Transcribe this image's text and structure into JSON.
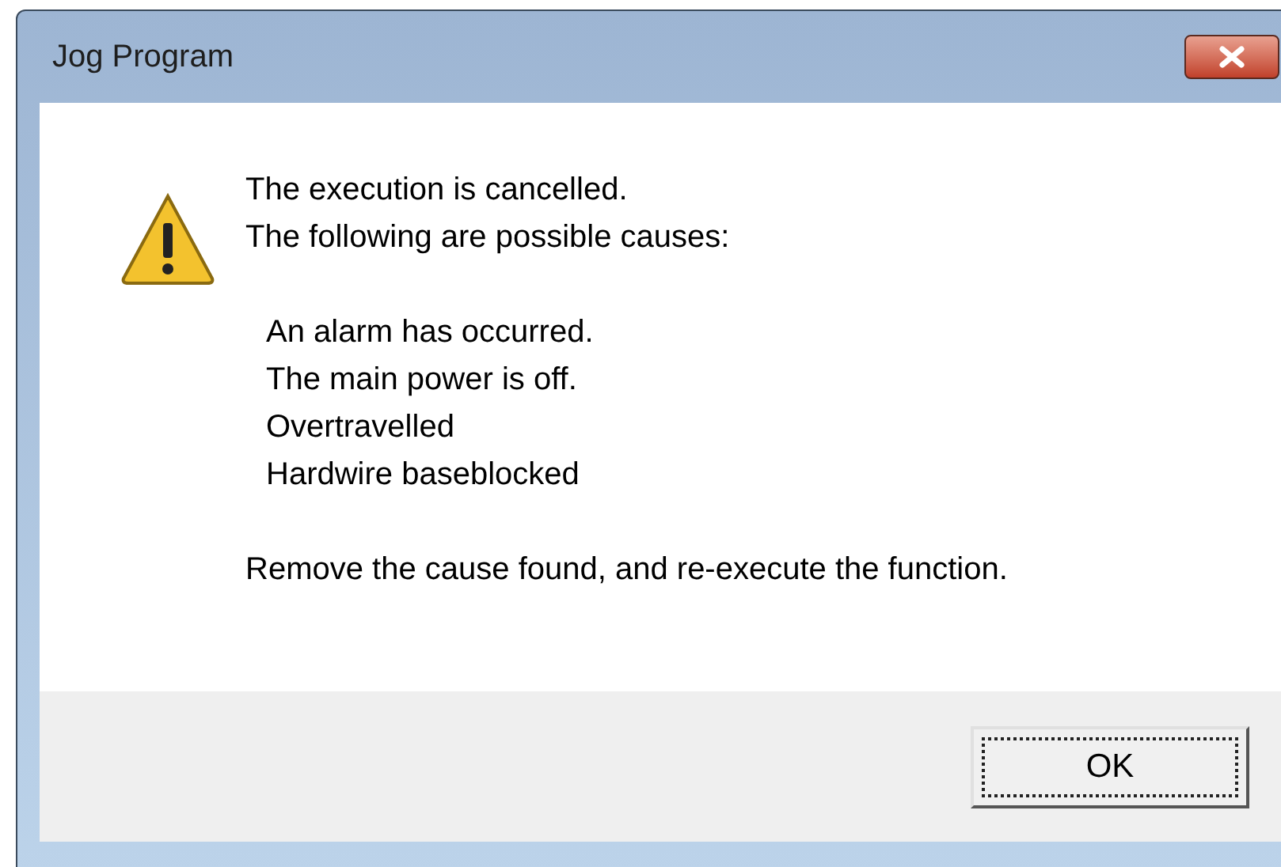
{
  "window": {
    "title": "Jog Program"
  },
  "message": {
    "lines": [
      "The execution is cancelled.",
      "The following are possible causes:"
    ],
    "causes": [
      "An alarm has occurred.",
      "The main power is off.",
      "Overtravelled",
      "Hardwire baseblocked"
    ],
    "closing": "Remove the cause found, and re-execute the function."
  },
  "buttons": [
    {
      "label": "OK",
      "focused": true
    }
  ]
}
